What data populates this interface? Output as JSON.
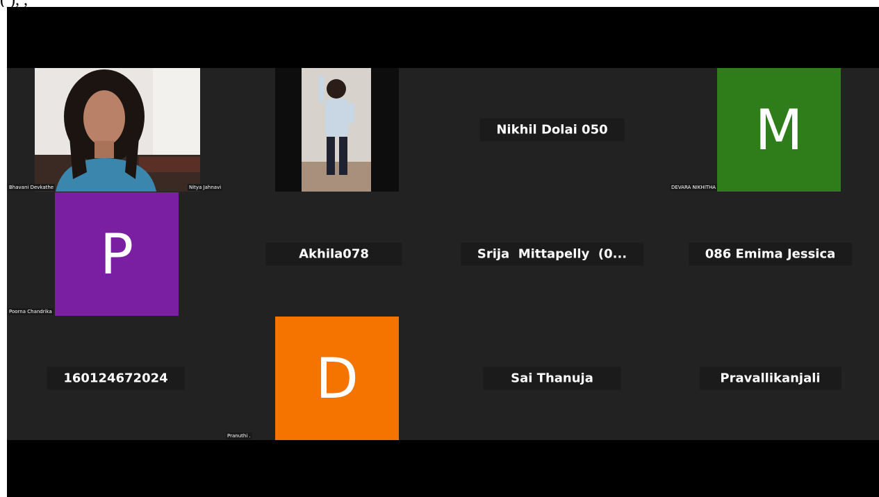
{
  "top_caption": "(  ), , ",
  "participants": [
    {
      "name": "Bhavani Devkathe",
      "display": "video"
    },
    {
      "name": "Nitya Jahnavi",
      "display": "video"
    },
    {
      "name": "Nikhil Dolai 050",
      "display": "name"
    },
    {
      "name": "DEVARA NIKHITHA",
      "display": "avatar",
      "initial": "M",
      "color": "#2e7d1a"
    },
    {
      "name": "Poorna Chandrika",
      "display": "avatar",
      "initial": "P",
      "color": "#7b1fa2"
    },
    {
      "name": "Akhila078",
      "display": "name"
    },
    {
      "name": "Srija  Mittapelly  (0...",
      "display": "name"
    },
    {
      "name": "086 Emima Jessica",
      "display": "name"
    },
    {
      "name": "160124672024",
      "display": "name"
    },
    {
      "name": "Pranuthi .",
      "display": "avatar",
      "initial": "D",
      "color": "#f57400"
    },
    {
      "name": "Sai Thanuja",
      "display": "name"
    },
    {
      "name": "Pravallikanjali",
      "display": "name"
    }
  ]
}
